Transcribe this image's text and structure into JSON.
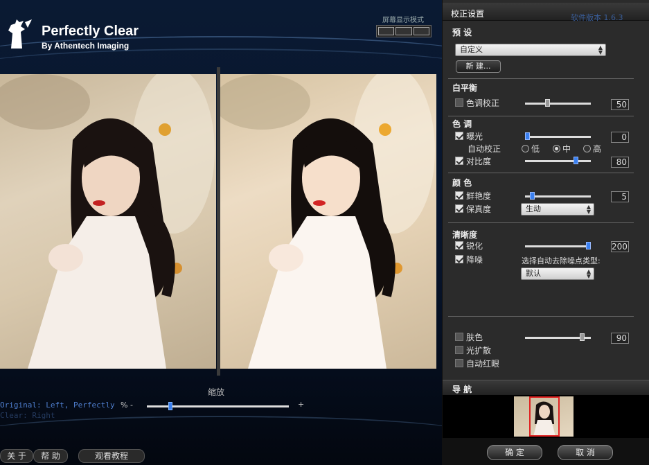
{
  "brand": {
    "title": "Perfectly Clear",
    "subtitle": "By Athentech Imaging"
  },
  "screen_mode": {
    "label": "屏幕显示模式"
  },
  "zoom": {
    "label": "缩放",
    "status_text": "Original: Left, Perfectly",
    "status_text2": "Clear: Right",
    "percent_label": "% -",
    "plus_label": "+"
  },
  "bottom_buttons": {
    "about": "关 于",
    "help": "帮 助",
    "tutorial": "观看教程"
  },
  "panel": {
    "title": "校正设置",
    "version": "软件版本 1.6.3",
    "preset": {
      "heading": "预 设",
      "selected": "自定义",
      "new_button": "新 建..."
    },
    "white_balance": {
      "heading": "白平衡",
      "tone_correction": {
        "label": "色调校正",
        "checked": false,
        "value": "50",
        "level": 0.33
      }
    },
    "tone": {
      "heading": "色 调",
      "exposure": {
        "label": "曝光",
        "checked": true,
        "value": "0",
        "level": 0.0
      },
      "auto_correct_label": "自动校正",
      "auto_options": [
        {
          "label": "低",
          "selected": false
        },
        {
          "label": "中",
          "selected": true
        },
        {
          "label": "高",
          "selected": false
        }
      ],
      "contrast": {
        "label": "对比度",
        "checked": true,
        "value": "80",
        "level": 0.8
      }
    },
    "color": {
      "heading": "颜 色",
      "vibrancy": {
        "label": "鲜艳度",
        "checked": true,
        "value": "5",
        "level": 0.08
      },
      "fidelity": {
        "label": "保真度",
        "checked": true,
        "selected": "生动"
      }
    },
    "sharpness": {
      "heading": "清晰度",
      "sharpen": {
        "label": "锐化",
        "checked": true,
        "value": "200",
        "level": 1.0
      },
      "denoise": {
        "label": "降噪",
        "checked": true
      },
      "denoise_type_label": "选择自动去除噪点类型:",
      "denoise_type": "默认"
    },
    "extras": {
      "skin": {
        "label": "肤色",
        "checked": false,
        "value": "90",
        "level": 0.9
      },
      "light_diffusion": {
        "label": "光扩散",
        "checked": false
      },
      "auto_redeye": {
        "label": "自动红眼",
        "checked": false
      }
    },
    "navigation": {
      "heading": "导 航"
    },
    "ok_button": "确 定",
    "cancel_button": "取 消"
  },
  "colors": {
    "accent_blue": "#3a80f0",
    "panel_bg": "#2b2b2b",
    "nav_frame": "#e02020"
  }
}
